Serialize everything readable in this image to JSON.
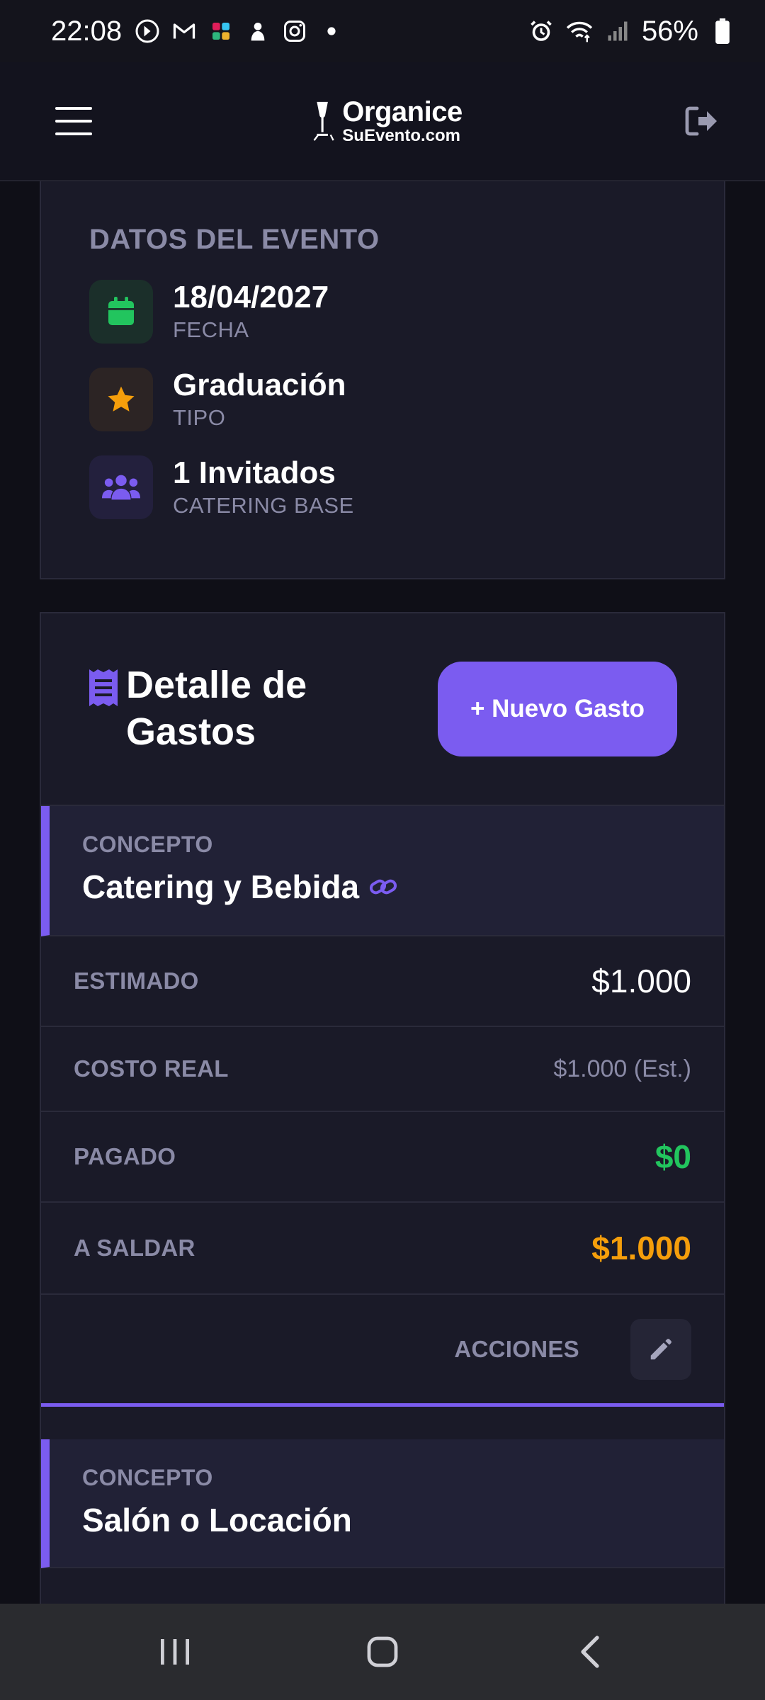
{
  "status_bar": {
    "time": "22:08",
    "battery": "56%",
    "notification_icons": [
      "whatsapp-icon",
      "gmail-icon",
      "slack-icon",
      "app-icon",
      "instagram-icon",
      "dot-icon"
    ],
    "system_icons": [
      "alarm-icon",
      "wifi-icon",
      "signal-icon",
      "battery-icon"
    ]
  },
  "header": {
    "logo_main": "Organice",
    "logo_sub": "SuEvento.com"
  },
  "event": {
    "section_title": "DATOS DEL EVENTO",
    "items": [
      {
        "value": "18/04/2027",
        "label": "FECHA",
        "icon": "calendar-icon",
        "color": "#22c55e"
      },
      {
        "value": "Graduación",
        "label": "TIPO",
        "icon": "star-icon",
        "color": "#f59e0b"
      },
      {
        "value": "1 Invitados",
        "label": "CATERING BASE",
        "icon": "users-icon",
        "color": "#7b5cf0"
      }
    ]
  },
  "expenses": {
    "title": "Detalle de Gastos",
    "new_button": "+ Nuevo Gasto",
    "items": [
      {
        "concept_label": "CONCEPTO",
        "concept": "Catering y Bebida",
        "rows": [
          {
            "label": "ESTIMADO",
            "value": "$1.000"
          },
          {
            "label": "COSTO REAL",
            "value": "$1.000 (Est.)"
          },
          {
            "label": "PAGADO",
            "value": "$0"
          },
          {
            "label": "A SALDAR",
            "value": "$1.000"
          }
        ],
        "actions_label": "ACCIONES"
      },
      {
        "concept_label": "CONCEPTO",
        "concept": "Salón o Locación"
      }
    ]
  },
  "colors": {
    "accent": "#7b5cf0",
    "paid": "#22c55e",
    "due": "#f59e0b",
    "muted": "#8a8aa6",
    "card_bg": "#1a1a28",
    "page_bg": "#0f0f17"
  }
}
